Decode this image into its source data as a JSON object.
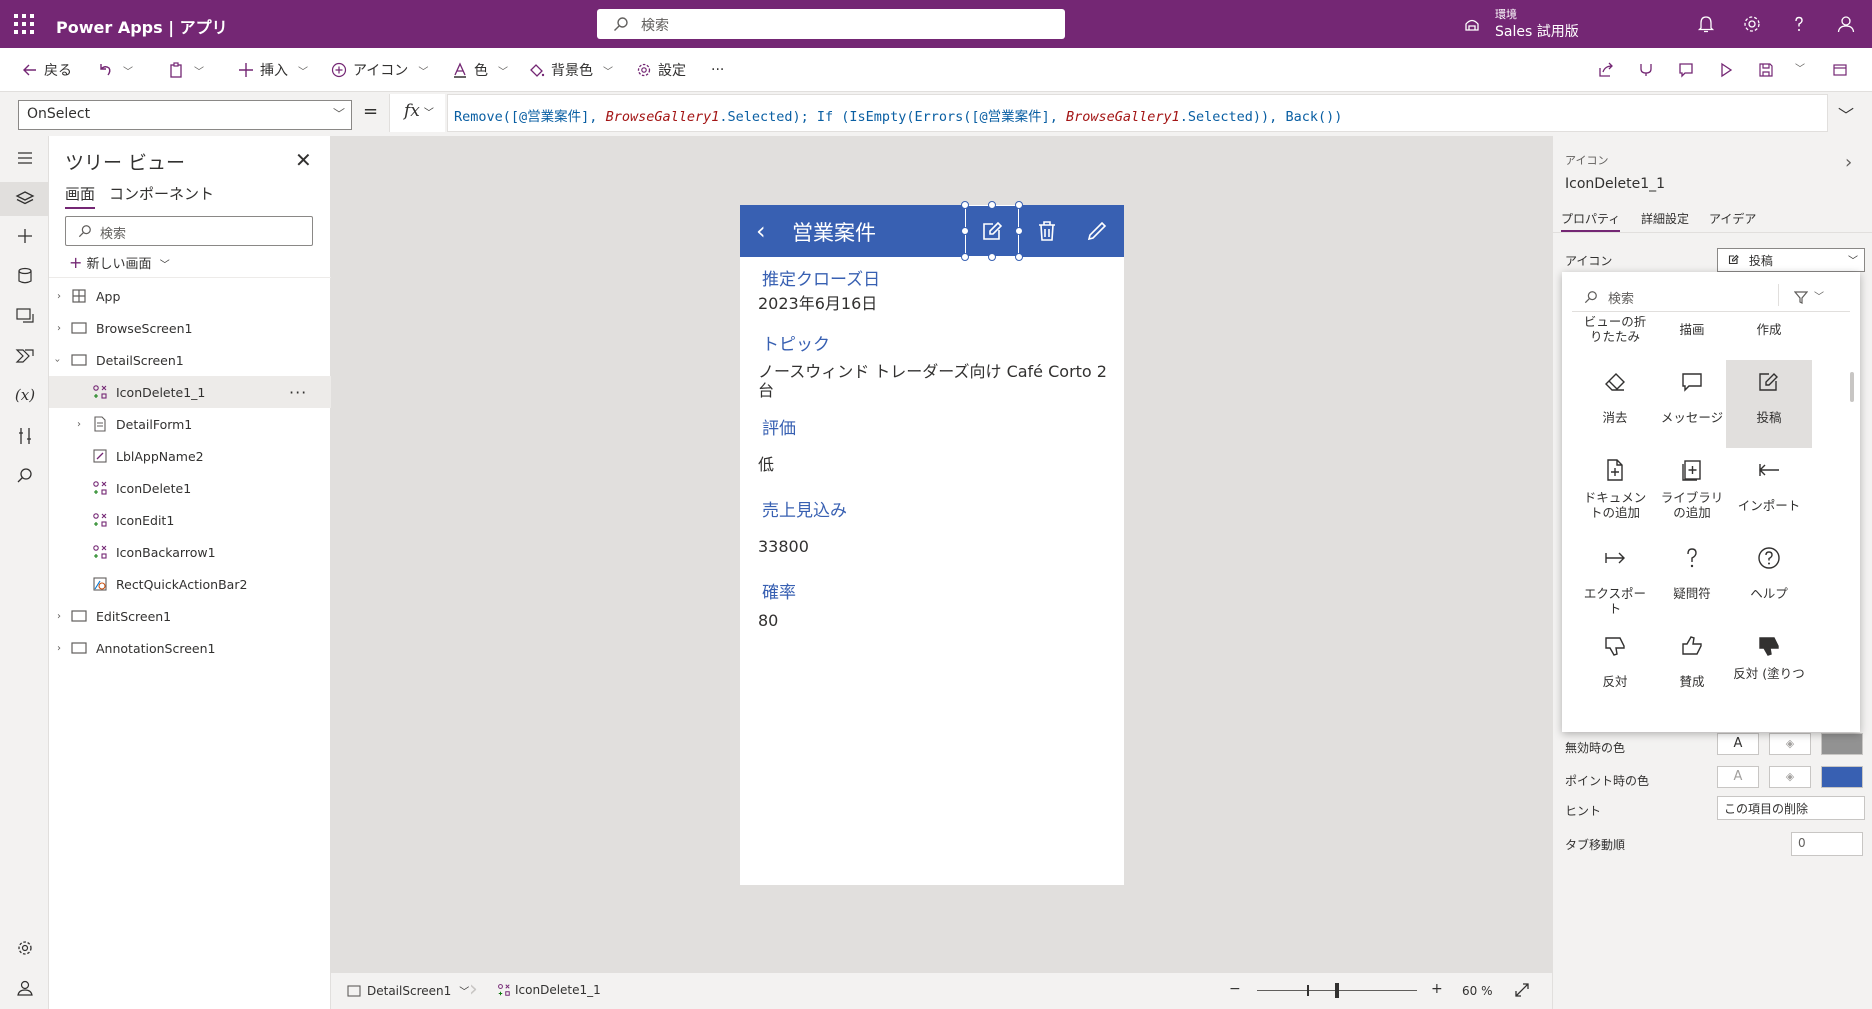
{
  "topbar": {
    "app_title": "Power Apps",
    "separator": "|",
    "app_section": "アプリ",
    "search_placeholder": "検索",
    "env_label": "環境",
    "env_name": "Sales 試用版"
  },
  "commands": {
    "back": "戻る",
    "insert": "挿入",
    "icon": "アイコン",
    "color": "色",
    "background": "背景色",
    "settings": "設定",
    "more": "···"
  },
  "formula": {
    "property": "OnSelect",
    "equals": "=",
    "fx": "fx",
    "parts": [
      {
        "t": "Remove",
        "c": "fn"
      },
      {
        "t": "([@営業案件], ",
        "c": "fn"
      },
      {
        "t": "BrowseGallery1",
        "c": "it"
      },
      {
        "t": ".Selected); ",
        "c": "fn"
      },
      {
        "t": "If ",
        "c": "fn"
      },
      {
        "t": "(IsEmpty(Errors([@営業案件], ",
        "c": "fn"
      },
      {
        "t": "BrowseGallery1",
        "c": "it"
      },
      {
        "t": ".Selected)), ",
        "c": "fn"
      },
      {
        "t": "Back())",
        "c": "fn"
      }
    ]
  },
  "tree": {
    "title": "ツリー ビュー",
    "tab_screens": "画面",
    "tab_components": "コンポーネント",
    "search_placeholder": "検索",
    "new_screen": "新しい画面",
    "items": [
      {
        "label": "App"
      },
      {
        "label": "BrowseScreen1"
      },
      {
        "label": "DetailScreen1"
      },
      {
        "label": "IconDelete1_1"
      },
      {
        "label": "DetailForm1"
      },
      {
        "label": "LblAppName2"
      },
      {
        "label": "IconDelete1"
      },
      {
        "label": "IconEdit1"
      },
      {
        "label": "IconBackarrow1"
      },
      {
        "label": "RectQuickActionBar2"
      },
      {
        "label": "EditScreen1"
      },
      {
        "label": "AnnotationScreen1"
      }
    ],
    "more": "···"
  },
  "screen": {
    "header_title": "営業案件",
    "fields": [
      {
        "label": "推定クローズ日",
        "value": "2023年6月16日"
      },
      {
        "label": "トピック",
        "value": "ノースウィンド トレーダーズ向け Café Corto 2 台"
      },
      {
        "label": "評価",
        "value": "低"
      },
      {
        "label": "売上見込み",
        "value": "33800"
      },
      {
        "label": "確率",
        "value": "80"
      }
    ]
  },
  "statusbar": {
    "screen": "DetailScreen1",
    "control": "IconDelete1_1",
    "zoom_minus": "−",
    "zoom_plus": "+",
    "zoom_percent": "60 %",
    "zoom_level": 0.6
  },
  "right_panel": {
    "type_label": "アイコン",
    "control_name": "IconDelete1_1",
    "tab_properties": "プロパティ",
    "tab_advanced": "詳細設定",
    "tab_ideas": "アイデア",
    "icon_prop_label": "アイコン",
    "icon_value": "投稿",
    "disabled_color_label": "無効時の色",
    "hover_color_label": "ポイント時の色",
    "swatch_text": "A",
    "tooltip_label": "ヒント",
    "tooltip_value": "この項目の削除",
    "tab_index_label": "タブ移動順",
    "tab_index_value": "0",
    "disabled_fill": "#929292",
    "hover_fill": "#3860b2"
  },
  "icon_picker": {
    "search_placeholder": "検索",
    "items": [
      {
        "name": "ビューの折りたたみ",
        "icon": "collapse-icon"
      },
      {
        "name": "描画",
        "icon": "draw-icon"
      },
      {
        "name": "作成",
        "icon": "compose-icon"
      },
      {
        "name": "消去",
        "icon": "erase-icon"
      },
      {
        "name": "メッセージ",
        "icon": "message-icon"
      },
      {
        "name": "投稿",
        "icon": "post-icon"
      },
      {
        "name": "ドキュメントの追加",
        "icon": "add-document-icon"
      },
      {
        "name": "ライブラリの追加",
        "icon": "add-library-icon"
      },
      {
        "name": "インポート",
        "icon": "import-icon"
      },
      {
        "name": "エクスポート",
        "icon": "export-icon"
      },
      {
        "name": "疑問符",
        "icon": "question-mark-icon"
      },
      {
        "name": "ヘルプ",
        "icon": "help-icon"
      },
      {
        "name": "反対",
        "icon": "thumbs-down-icon"
      },
      {
        "name": "賛成",
        "icon": "thumbs-up-icon"
      },
      {
        "name": "反対 (塗りつ",
        "icon": "thumbs-down-filled-icon"
      }
    ]
  },
  "colors": {
    "brand": "#742774",
    "screen_header": "#3860b2",
    "field_label": "#3860b2"
  }
}
